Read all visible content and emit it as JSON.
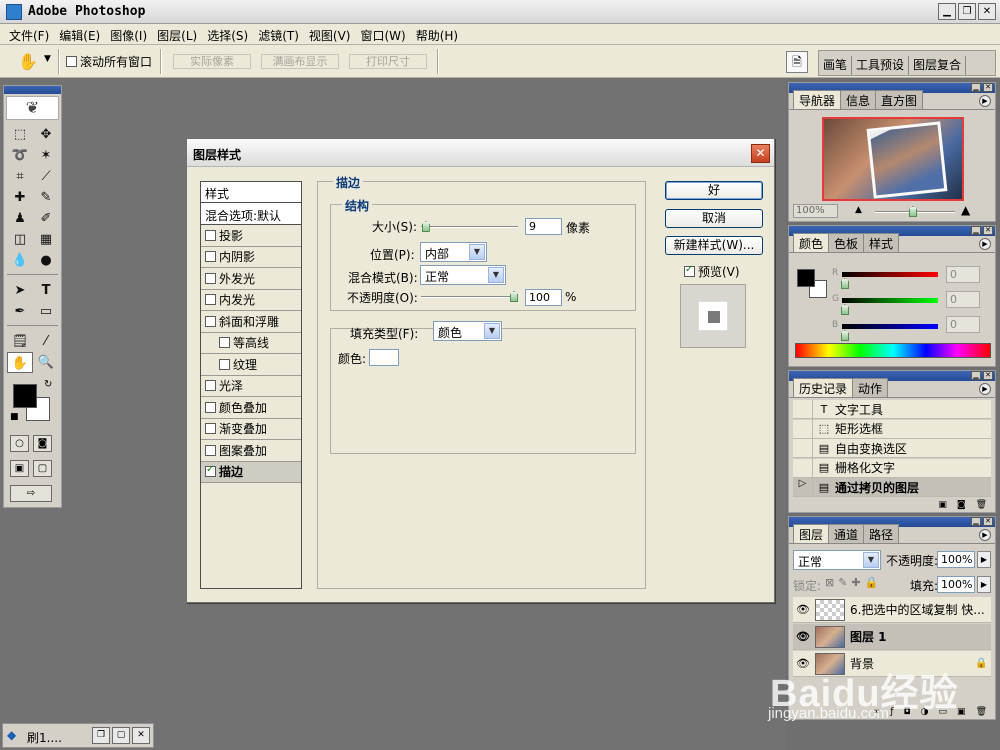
{
  "window": {
    "title": "Adobe Photoshop"
  },
  "menu": [
    "文件(F)",
    "编辑(E)",
    "图像(I)",
    "图层(L)",
    "选择(S)",
    "滤镜(T)",
    "视图(V)",
    "窗口(W)",
    "帮助(H)"
  ],
  "options_bar": {
    "scroll_all_windows": "滚动所有窗口",
    "actual_pixels": "实际像素",
    "fit_on_screen": "满画布显示",
    "print_size": "打印尺寸",
    "palette_well_tabs": [
      "画笔",
      "工具预设",
      "图层复合"
    ]
  },
  "taskbar_doc": {
    "label": "刷1...."
  },
  "dialog": {
    "title": "图层样式",
    "style_list": {
      "header": "样式",
      "blend_options": "混合选项:默认",
      "items": [
        {
          "label": "投影",
          "checked": false,
          "indent": false
        },
        {
          "label": "内阴影",
          "checked": false,
          "indent": false
        },
        {
          "label": "外发光",
          "checked": false,
          "indent": false
        },
        {
          "label": "内发光",
          "checked": false,
          "indent": false
        },
        {
          "label": "斜面和浮雕",
          "checked": false,
          "indent": false
        },
        {
          "label": "等高线",
          "checked": false,
          "indent": true
        },
        {
          "label": "纹理",
          "checked": false,
          "indent": true
        },
        {
          "label": "光泽",
          "checked": false,
          "indent": false
        },
        {
          "label": "颜色叠加",
          "checked": false,
          "indent": false
        },
        {
          "label": "渐变叠加",
          "checked": false,
          "indent": false
        },
        {
          "label": "图案叠加",
          "checked": false,
          "indent": false
        },
        {
          "label": "描边",
          "checked": true,
          "indent": false
        }
      ]
    },
    "stroke": {
      "group_label": "描边",
      "structure_label": "结构",
      "size_label": "大小(S):",
      "size_value": "9",
      "size_unit": "像素",
      "size_level": 0.05,
      "position_label": "位置(P):",
      "position_value": "内部",
      "blend_mode_label": "混合模式(B):",
      "blend_mode_value": "正常",
      "opacity_label": "不透明度(O):",
      "opacity_value": "100",
      "opacity_unit": "%",
      "opacity_level": 1.0,
      "fill_type_label": "填充类型(F):",
      "fill_type_value": "颜色",
      "color_label": "颜色:"
    },
    "buttons": {
      "ok": "好",
      "cancel": "取消",
      "new_style": "新建样式(W)...",
      "preview": "预览(V)",
      "preview_checked": true
    }
  },
  "navigator": {
    "tabs": [
      "导航器",
      "信息",
      "直方图"
    ],
    "zoom": "100%"
  },
  "color_palette": {
    "tabs": [
      "颜色",
      "色板",
      "样式"
    ],
    "channels": [
      {
        "label": "R",
        "value": "0"
      },
      {
        "label": "G",
        "value": "0"
      },
      {
        "label": "B",
        "value": "0"
      }
    ]
  },
  "history": {
    "tabs": [
      "历史记录",
      "动作"
    ],
    "items": [
      {
        "label": "文字工具",
        "icon": "type-tool-icon",
        "selected": false
      },
      {
        "label": "矩形选框",
        "icon": "marquee-icon",
        "selected": false
      },
      {
        "label": "自由变换选区",
        "icon": "history-step-icon",
        "selected": false
      },
      {
        "label": "栅格化文字",
        "icon": "history-step-icon",
        "selected": false
      },
      {
        "label": "通过拷贝的图层",
        "icon": "history-step-icon",
        "selected": true
      }
    ]
  },
  "layers": {
    "tabs": [
      "图层",
      "通道",
      "路径"
    ],
    "blend_mode": "正常",
    "opacity_label": "不透明度:",
    "opacity_value": "100%",
    "lock_label": "锁定:",
    "fill_label": "填充:",
    "fill_value": "100%",
    "items": [
      {
        "name": "6.把选中的区域复制 快...",
        "thumb": "checker",
        "selected": false,
        "locked": false
      },
      {
        "name": "图层 1",
        "thumb": "photo",
        "selected": true,
        "locked": false
      },
      {
        "name": "背景",
        "thumb": "photo",
        "selected": false,
        "locked": true
      }
    ]
  },
  "watermark": {
    "brand": "Baidu经验",
    "url": "jingyan.baidu.com"
  }
}
